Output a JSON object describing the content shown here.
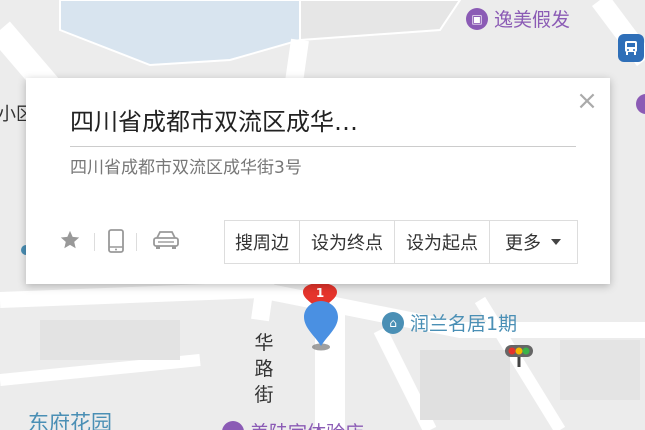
{
  "popup": {
    "title": "四川省成都市双流区成华…",
    "address": "四川省成都市双流区成华街3号",
    "close_glyph": "×",
    "actions": [
      {
        "label": "搜周边"
      },
      {
        "label": "设为终点"
      },
      {
        "label": "设为起点"
      },
      {
        "label": "更多"
      }
    ],
    "icons": [
      "star-icon",
      "phone-icon",
      "car-icon"
    ]
  },
  "map": {
    "pois": [
      {
        "label": "逸美假发",
        "icon": "shop-icon",
        "color": "#8b5bb5"
      },
      {
        "label": "润兰名居1期",
        "icon": "residential-icon",
        "color": "#4a8fb5"
      }
    ],
    "partial_labels": {
      "left_edge": "小区",
      "bottom_left": "东府花园",
      "bottom_center": "美陆宇体验店"
    },
    "street_name": [
      "华",
      "路",
      "街"
    ],
    "marker_number": "1",
    "colors": {
      "marker_blue": "#4a90e2",
      "marker_red": "#e5342c",
      "poi_purple": "#8b5bb5",
      "poi_teal": "#4a8fb5",
      "bus_blue": "#2f6fb8"
    }
  }
}
